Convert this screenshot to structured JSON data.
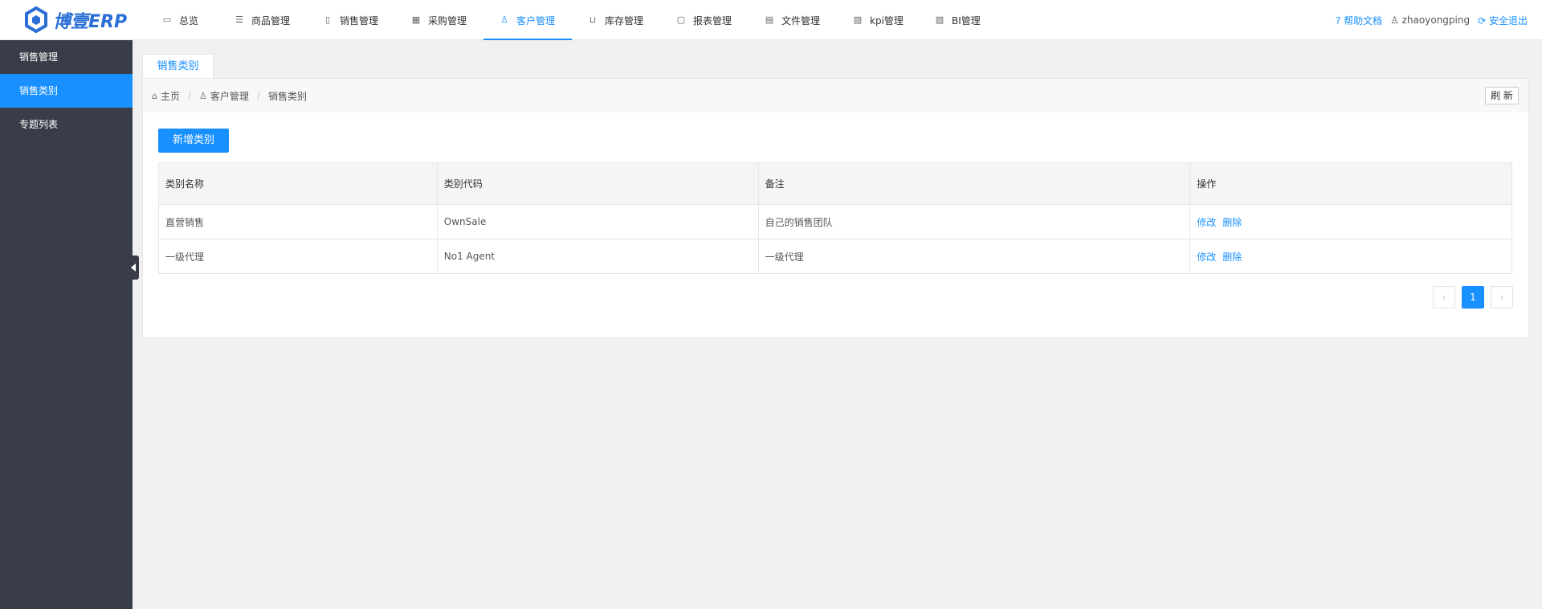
{
  "brand": {
    "logo_text": "博壹ERP"
  },
  "nav": {
    "items": [
      {
        "label": "总览",
        "icon": "monitor-icon",
        "glyph": "▭"
      },
      {
        "label": "商品管理",
        "icon": "list-icon",
        "glyph": "☰"
      },
      {
        "label": "销售管理",
        "icon": "tablet-icon",
        "glyph": "▯"
      },
      {
        "label": "采购管理",
        "icon": "grid-icon",
        "glyph": "▦"
      },
      {
        "label": "客户管理",
        "icon": "user-icon",
        "glyph": "♙"
      },
      {
        "label": "库存管理",
        "icon": "cart-icon",
        "glyph": "⊔"
      },
      {
        "label": "报表管理",
        "icon": "file-icon",
        "glyph": "▢"
      },
      {
        "label": "文件管理",
        "icon": "document-icon",
        "glyph": "▤"
      },
      {
        "label": "kpi管理",
        "icon": "chart-icon",
        "glyph": "▧"
      },
      {
        "label": "BI管理",
        "icon": "chart-icon",
        "glyph": "▧"
      }
    ],
    "active_index": 4,
    "help": "? 帮助文档",
    "user": "zhaoyongping",
    "logout": "安全退出"
  },
  "sidebar": {
    "items": [
      {
        "label": "销售管理"
      },
      {
        "label": "销售类别"
      },
      {
        "label": "专题列表"
      }
    ],
    "active_index": 1
  },
  "tab": {
    "label": "销售类别"
  },
  "breadcrumb": {
    "home": "主页",
    "section": "客户管理",
    "current": "销售类别",
    "separator": "/"
  },
  "toolbar": {
    "refresh_label": "刷 新",
    "add_label": "新增类别"
  },
  "table": {
    "headers": [
      "类别名称",
      "类别代码",
      "备注",
      "操作"
    ],
    "rows": [
      {
        "name": "直营销售",
        "code": "OwnSale",
        "note": "自己的销售团队",
        "edit": "修改",
        "del": "删除"
      },
      {
        "name": "一级代理",
        "code": "No1 Agent",
        "note": "一级代理",
        "edit": "修改",
        "del": "删除"
      }
    ]
  },
  "pager": {
    "prev": "‹",
    "current": "1",
    "next": "›"
  },
  "colors": {
    "accent": "#1890ff",
    "sidebar_bg": "#393d49",
    "page_bg": "#f0f0f0"
  }
}
